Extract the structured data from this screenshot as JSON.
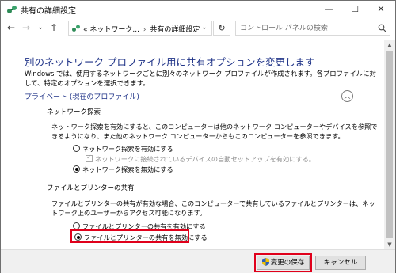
{
  "window": {
    "title": "共有の詳細設定",
    "minimize": "—",
    "maximize": "☐",
    "close": "✕"
  },
  "nav": {
    "back": "←",
    "forward": "→",
    "recent": "⌄",
    "up": "↑",
    "breadcrumb_prefix": "«",
    "breadcrumb_1": "ネットワーク...",
    "breadcrumb_sep": "›",
    "breadcrumb_2": "共有の詳細設定",
    "dropdown": "⌄",
    "refresh": "↻",
    "search_placeholder": "コントロール パネルの検索"
  },
  "main": {
    "heading": "別のネットワーク プロファイル用に共有オプションを変更します",
    "description": "Windows では、使用するネットワークごとに別々のネットワーク プロファイルが作成されます。各プロファイルに対して、特定のオプションを選択できます。",
    "profile_title": "プライベート (現在のプロファイル)",
    "collapse_glyph": "︿",
    "discovery": {
      "heading": "ネットワーク探索",
      "text": "ネットワーク探索を有効にすると、このコンピューターは他のネットワーク コンピューターやデバイスを参照できるようになり、また他のネットワーク コンピューターからもこのコンピューターを参照できます。",
      "option_on": "ネットワーク探索を有効にする",
      "auto_setup": "ネットワークに接続されているデバイスの自動セットアップを有効にする。",
      "option_off": "ネットワーク探索を無効にする",
      "selected": "off",
      "auto_setup_checked": true
    },
    "sharing": {
      "heading": "ファイルとプリンターの共有",
      "text": "ファイルとプリンターの共有が有効な場合、このコンピューターで共有しているファイルとプリンターは、ネットワーク上のユーザーからアクセス可能になります。",
      "option_on": "ファイルとプリンターの共有を有効にする",
      "option_off": "ファイルとプリンターの共有を無効にする",
      "selected": "off"
    }
  },
  "footer": {
    "save_label": "変更の保存",
    "cancel_label": "キャンセル"
  },
  "colors": {
    "heading": "#1e3287",
    "highlight": "#e0001b",
    "bottom_bar": "#f0f0f0"
  }
}
